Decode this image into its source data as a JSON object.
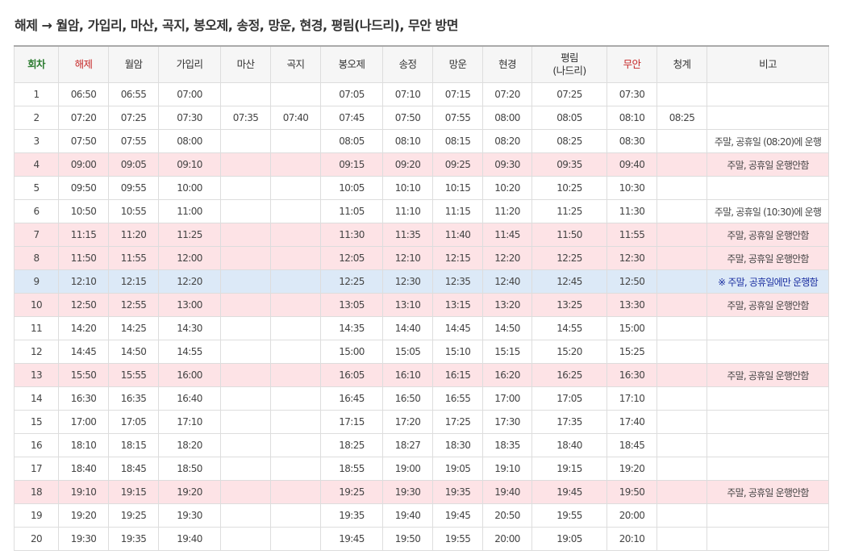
{
  "page": {
    "title": "해제 → 월암, 가입리, 마산, 곡지, 봉오제, 송정, 망운, 현경, 평림(나드리), 무안 방면"
  },
  "colors": {
    "header_green": "#2e7d32",
    "header_red": "#c62828",
    "row_pink": "#fde3e6",
    "row_blue": "#dce9f7",
    "note_red": "#b52a3c",
    "note_blue": "#1a2ea0"
  },
  "table": {
    "headers": {
      "no": "회차",
      "haeje": "해제",
      "wolam": "월암",
      "gaipri": "가입리",
      "masan": "마산",
      "gokji": "곡지",
      "bongoje": "봉오제",
      "songjeong": "송정",
      "mangun": "망운",
      "hyeongyeong": "현경",
      "pyeongrim_1": "평림",
      "pyeongrim_2": "(나드리)",
      "muan": "무안",
      "cheonggye": "청계",
      "note": "비고"
    },
    "rows": [
      {
        "no": "1",
        "haeje": "06:50",
        "wolam": "06:55",
        "gaipri": "07:00",
        "masan": "",
        "gokji": "",
        "bongoje": "07:05",
        "songjeong": "07:10",
        "mangun": "07:15",
        "hyeongyeong": "07:20",
        "pyeongrim": "07:25",
        "muan": "07:30",
        "cheonggye": "",
        "note": "",
        "style": "normal"
      },
      {
        "no": "2",
        "haeje": "07:20",
        "wolam": "07:25",
        "gaipri": "07:30",
        "masan": "07:35",
        "gokji": "07:40",
        "bongoje": "07:45",
        "songjeong": "07:50",
        "mangun": "07:55",
        "hyeongyeong": "08:00",
        "pyeongrim": "08:05",
        "muan": "08:10",
        "cheonggye": "08:25",
        "note": "",
        "style": "normal"
      },
      {
        "no": "3",
        "haeje": "07:50",
        "wolam": "07:55",
        "gaipri": "08:00",
        "masan": "",
        "gokji": "",
        "bongoje": "08:05",
        "songjeong": "08:10",
        "mangun": "08:15",
        "hyeongyeong": "08:20",
        "pyeongrim": "08:25",
        "muan": "08:30",
        "cheonggye": "",
        "note": "주말, 공휴일 (08:20)에 운행",
        "style": "normal"
      },
      {
        "no": "4",
        "haeje": "09:00",
        "wolam": "09:05",
        "gaipri": "09:10",
        "masan": "",
        "gokji": "",
        "bongoje": "09:15",
        "songjeong": "09:20",
        "mangun": "09:25",
        "hyeongyeong": "09:30",
        "pyeongrim": "09:35",
        "muan": "09:40",
        "cheonggye": "",
        "note": "주말, 공휴일 운행안함",
        "style": "pink"
      },
      {
        "no": "5",
        "haeje": "09:50",
        "wolam": "09:55",
        "gaipri": "10:00",
        "masan": "",
        "gokji": "",
        "bongoje": "10:05",
        "songjeong": "10:10",
        "mangun": "10:15",
        "hyeongyeong": "10:20",
        "pyeongrim": "10:25",
        "muan": "10:30",
        "cheonggye": "",
        "note": "",
        "style": "normal"
      },
      {
        "no": "6",
        "haeje": "10:50",
        "wolam": "10:55",
        "gaipri": "11:00",
        "masan": "",
        "gokji": "",
        "bongoje": "11:05",
        "songjeong": "11:10",
        "mangun": "11:15",
        "hyeongyeong": "11:20",
        "pyeongrim": "11:25",
        "muan": "11:30",
        "cheonggye": "",
        "note": "주말, 공휴일 (10:30)에 운행",
        "style": "normal"
      },
      {
        "no": "7",
        "haeje": "11:15",
        "wolam": "11:20",
        "gaipri": "11:25",
        "masan": "",
        "gokji": "",
        "bongoje": "11:30",
        "songjeong": "11:35",
        "mangun": "11:40",
        "hyeongyeong": "11:45",
        "pyeongrim": "11:50",
        "muan": "11:55",
        "cheonggye": "",
        "note": "주말, 공휴일 운행안함",
        "style": "pink"
      },
      {
        "no": "8",
        "haeje": "11:50",
        "wolam": "11:55",
        "gaipri": "12:00",
        "masan": "",
        "gokji": "",
        "bongoje": "12:05",
        "songjeong": "12:10",
        "mangun": "12:15",
        "hyeongyeong": "12:20",
        "pyeongrim": "12:25",
        "muan": "12:30",
        "cheonggye": "",
        "note": "주말, 공휴일 운행안함",
        "style": "pink"
      },
      {
        "no": "9",
        "haeje": "12:10",
        "wolam": "12:15",
        "gaipri": "12:20",
        "masan": "",
        "gokji": "",
        "bongoje": "12:25",
        "songjeong": "12:30",
        "mangun": "12:35",
        "hyeongyeong": "12:40",
        "pyeongrim": "12:45",
        "muan": "12:50",
        "cheonggye": "",
        "note": "※ 주말, 공휴일에만 운행함",
        "style": "blue"
      },
      {
        "no": "10",
        "haeje": "12:50",
        "wolam": "12:55",
        "gaipri": "13:00",
        "masan": "",
        "gokji": "",
        "bongoje": "13:05",
        "songjeong": "13:10",
        "mangun": "13:15",
        "hyeongyeong": "13:20",
        "pyeongrim": "13:25",
        "muan": "13:30",
        "cheonggye": "",
        "note": "주말, 공휴일 운행안함",
        "style": "pink"
      },
      {
        "no": "11",
        "haeje": "14:20",
        "wolam": "14:25",
        "gaipri": "14:30",
        "masan": "",
        "gokji": "",
        "bongoje": "14:35",
        "songjeong": "14:40",
        "mangun": "14:45",
        "hyeongyeong": "14:50",
        "pyeongrim": "14:55",
        "muan": "15:00",
        "cheonggye": "",
        "note": "",
        "style": "normal"
      },
      {
        "no": "12",
        "haeje": "14:45",
        "wolam": "14:50",
        "gaipri": "14:55",
        "masan": "",
        "gokji": "",
        "bongoje": "15:00",
        "songjeong": "15:05",
        "mangun": "15:10",
        "hyeongyeong": "15:15",
        "pyeongrim": "15:20",
        "muan": "15:25",
        "cheonggye": "",
        "note": "",
        "style": "normal"
      },
      {
        "no": "13",
        "haeje": "15:50",
        "wolam": "15:55",
        "gaipri": "16:00",
        "masan": "",
        "gokji": "",
        "bongoje": "16:05",
        "songjeong": "16:10",
        "mangun": "16:15",
        "hyeongyeong": "16:20",
        "pyeongrim": "16:25",
        "muan": "16:30",
        "cheonggye": "",
        "note": "주말, 공휴일 운행안함",
        "style": "pink"
      },
      {
        "no": "14",
        "haeje": "16:30",
        "wolam": "16:35",
        "gaipri": "16:40",
        "masan": "",
        "gokji": "",
        "bongoje": "16:45",
        "songjeong": "16:50",
        "mangun": "16:55",
        "hyeongyeong": "17:00",
        "pyeongrim": "17:05",
        "muan": "17:10",
        "cheonggye": "",
        "note": "",
        "style": "normal"
      },
      {
        "no": "15",
        "haeje": "17:00",
        "wolam": "17:05",
        "gaipri": "17:10",
        "masan": "",
        "gokji": "",
        "bongoje": "17:15",
        "songjeong": "17:20",
        "mangun": "17:25",
        "hyeongyeong": "17:30",
        "pyeongrim": "17:35",
        "muan": "17:40",
        "cheonggye": "",
        "note": "",
        "style": "normal"
      },
      {
        "no": "16",
        "haeje": "18:10",
        "wolam": "18:15",
        "gaipri": "18:20",
        "masan": "",
        "gokji": "",
        "bongoje": "18:25",
        "songjeong": "18:27",
        "mangun": "18:30",
        "hyeongyeong": "18:35",
        "pyeongrim": "18:40",
        "muan": "18:45",
        "cheonggye": "",
        "note": "",
        "style": "normal"
      },
      {
        "no": "17",
        "haeje": "18:40",
        "wolam": "18:45",
        "gaipri": "18:50",
        "masan": "",
        "gokji": "",
        "bongoje": "18:55",
        "songjeong": "19:00",
        "mangun": "19:05",
        "hyeongyeong": "19:10",
        "pyeongrim": "19:15",
        "muan": "19:20",
        "cheonggye": "",
        "note": "",
        "style": "normal"
      },
      {
        "no": "18",
        "haeje": "19:10",
        "wolam": "19:15",
        "gaipri": "19:20",
        "masan": "",
        "gokji": "",
        "bongoje": "19:25",
        "songjeong": "19:30",
        "mangun": "19:35",
        "hyeongyeong": "19:40",
        "pyeongrim": "19:45",
        "muan": "19:50",
        "cheonggye": "",
        "note": "주말, 공휴일 운행안함",
        "style": "pink"
      },
      {
        "no": "19",
        "haeje": "19:20",
        "wolam": "19:25",
        "gaipri": "19:30",
        "masan": "",
        "gokji": "",
        "bongoje": "19:35",
        "songjeong": "19:40",
        "mangun": "19:45",
        "hyeongyeong": "20:50",
        "pyeongrim": "19:55",
        "muan": "20:00",
        "cheonggye": "",
        "note": "",
        "style": "normal"
      },
      {
        "no": "20",
        "haeje": "19:30",
        "wolam": "19:35",
        "gaipri": "19:40",
        "masan": "",
        "gokji": "",
        "bongoje": "19:45",
        "songjeong": "19:50",
        "mangun": "19:55",
        "hyeongyeong": "20:00",
        "pyeongrim": "19:05",
        "muan": "20:10",
        "cheonggye": "",
        "note": "",
        "style": "normal"
      }
    ]
  }
}
